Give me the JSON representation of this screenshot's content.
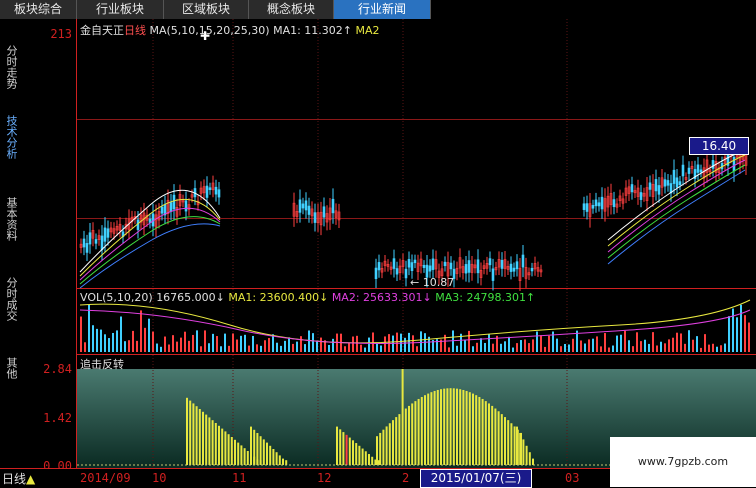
{
  "tabs": [
    "板块综合",
    "行业板块",
    "区域板块",
    "概念板块",
    "行业新闻"
  ],
  "active_tab": 4,
  "sidebar": [
    "分时走势",
    "技术分析",
    "基本资料",
    "分时成交",
    "其他"
  ],
  "active_sidebar": 1,
  "title": "金自天正",
  "period": "日线",
  "ma_legend": {
    "label": "MA(5,10,15,20,25,30)",
    "ma1": "MA1: 11.302↑",
    "ma2": "MA2"
  },
  "vol_legend": {
    "label": "VOL(5,10,20)",
    "vol": "16765.000↓",
    "ma1": "MA1: 23600.400↓",
    "ma2": "MA2: 25633.301↓",
    "ma3": "MA3: 24798.301↑"
  },
  "indicator_name": "追击反转",
  "indicator_axis": [
    "2.84",
    "1.42",
    "0.00"
  ],
  "top_clip": "213",
  "last_price": "16.40",
  "low_label": "10.87",
  "bottom": {
    "day_button": "日线",
    "labels": [
      "2014/09",
      "10",
      "11",
      "12",
      "2",
      "03"
    ],
    "date_box": "2015/01/07(三)"
  },
  "watermark": "www.7gpzb.com",
  "colors": {
    "red": "#d02020",
    "up": "#ff4040",
    "down": "#40d0ff",
    "ma1": "#ffffff",
    "ma2": "#e8e840",
    "ma3": "#e040e0",
    "ma4": "#40e040",
    "ma5": "#4080ff",
    "ind": "#e8e840"
  }
}
